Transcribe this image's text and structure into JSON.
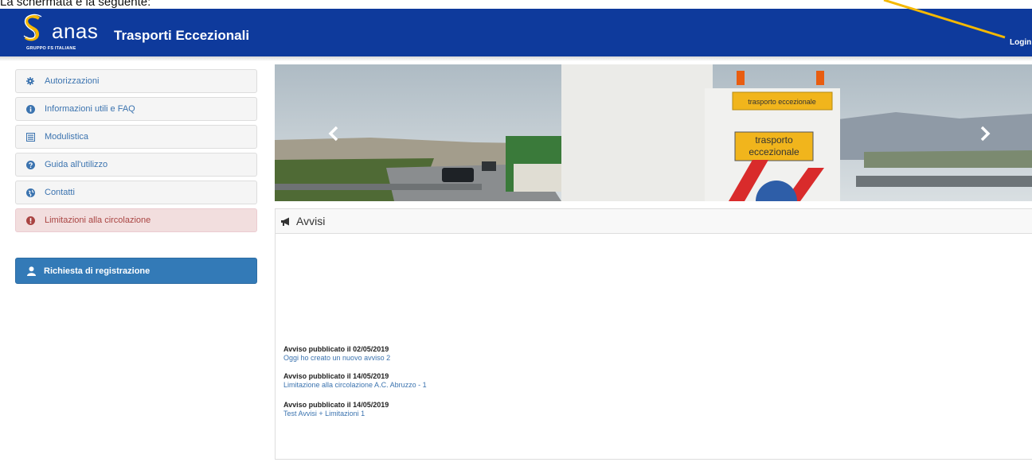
{
  "caption": "La schermata è la seguente:",
  "header": {
    "logo_text": "anas",
    "logo_subtitle": "GRUPPO FS ITALIANE",
    "app_title": "Trasporti Eccezionali",
    "login_label": "Login",
    "bg_color": "#0e3a9c",
    "arrow_color": "#f5b800"
  },
  "sidebar": {
    "items": [
      {
        "label": "Autorizzazioni",
        "icon": "gear-icon"
      },
      {
        "label": "Informazioni utili e FAQ",
        "icon": "info-circle-icon"
      },
      {
        "label": "Modulistica",
        "icon": "list-icon"
      },
      {
        "label": "Guida all'utilizzo",
        "icon": "question-circle-icon"
      },
      {
        "label": "Contatti",
        "icon": "globe-icon"
      },
      {
        "label": "Limitazioni alla circolazione",
        "icon": "exclamation-circle-icon"
      }
    ],
    "register_label": "Richiesta di registrazione",
    "register_icon": "user-icon"
  },
  "carousel": {
    "sign_top": "trasporto eccezionale",
    "sign_main_line1": "trasporto",
    "sign_main_line2": "eccezionale",
    "prev_icon": "chevron-left-icon",
    "next_icon": "chevron-right-icon"
  },
  "avvisi": {
    "title": "Avvisi",
    "icon": "bullhorn-icon",
    "notices": [
      {
        "date": "Avviso pubblicato il 02/05/2019",
        "text": "Oggi ho creato un nuovo avviso 2"
      },
      {
        "date": "Avviso pubblicato il 14/05/2019",
        "text": "Limitazione alla circolazione A.C. Abruzzo - 1"
      },
      {
        "date": "Avviso pubblicato il 14/05/2019",
        "text": "Test Avvisi + Limitazioni 1"
      }
    ]
  }
}
